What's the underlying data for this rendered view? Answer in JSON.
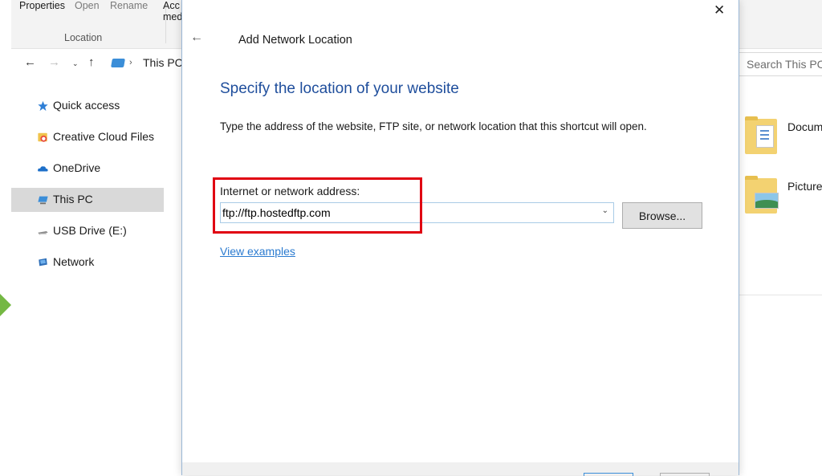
{
  "explorer": {
    "ribbon": {
      "properties": "Properties",
      "open": "Open",
      "rename": "Rename",
      "access_line1": "Acc",
      "access_line2": "med",
      "group_label": "Location"
    },
    "breadcrumb": {
      "location": "This PC"
    },
    "search": {
      "placeholder": "Search This PC"
    },
    "sidebar": {
      "items": [
        {
          "label": "Quick access",
          "icon": "star-icon"
        },
        {
          "label": "Creative Cloud Files",
          "icon": "creative-cloud-icon"
        },
        {
          "label": "OneDrive",
          "icon": "cloud-icon"
        },
        {
          "label": "This PC",
          "icon": "computer-icon",
          "selected": true
        },
        {
          "label": "USB Drive (E:)",
          "icon": "usb-drive-icon"
        },
        {
          "label": "Network",
          "icon": "network-icon"
        }
      ]
    },
    "folders": [
      {
        "label": "Docum",
        "icon": "documents-folder-icon"
      },
      {
        "label": "Picture",
        "icon": "pictures-folder-icon"
      }
    ]
  },
  "dialog": {
    "title": "Add Network Location",
    "heading": "Specify the location of your website",
    "instruction": "Type the address of the website, FTP site, or network location that this shortcut will open.",
    "address_label": "Internet or network address:",
    "address_value": "ftp://ftp.hostedftp.com",
    "browse_label": "Browse...",
    "examples_link": "View examples",
    "close_glyph": "✕",
    "back_glyph": "←",
    "highlight_color": "#e00012",
    "heading_color": "#1f4e9c"
  }
}
